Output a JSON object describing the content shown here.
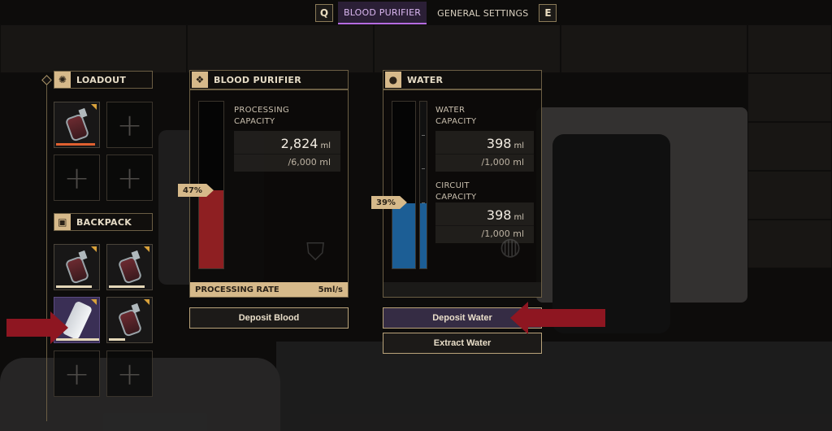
{
  "tabs": {
    "prev_key": "Q",
    "next_key": "E",
    "items": [
      {
        "label": "BLOOD PURIFIER",
        "active": true
      },
      {
        "label": "GENERAL SETTINGS",
        "active": false
      }
    ]
  },
  "loadout": {
    "title": "LOADOUT",
    "slots": [
      {
        "item": "blood-pack",
        "durability": 0.8
      },
      {
        "item": "empty"
      },
      {
        "item": "empty"
      },
      {
        "item": "empty"
      }
    ]
  },
  "backpack": {
    "title": "BACKPACK",
    "slots": [
      {
        "item": "blood-pack",
        "durability": 0.8
      },
      {
        "item": "blood-pack",
        "durability": 0.8
      },
      {
        "item": "water-canister",
        "durability": 1.0,
        "selected": true
      },
      {
        "item": "blood-pack",
        "durability": 0.35
      },
      {
        "item": "empty"
      },
      {
        "item": "empty"
      }
    ]
  },
  "blood_purifier": {
    "title": "BLOOD PURIFIER",
    "gauge_percent": "47%",
    "fill_fraction": 0.47,
    "fill_color": "#8e1f22",
    "stat_label_line1": "PROCESSING",
    "stat_label_line2": "CAPACITY",
    "value": "2,824",
    "unit": "ml",
    "max": "/6,000 ml",
    "rate_label": "PROCESSING RATE",
    "rate_value": "5ml/s",
    "deposit_button": "Deposit Blood"
  },
  "water": {
    "title": "WATER",
    "gauge_percent": "39%",
    "fill_fraction": 0.39,
    "fill_color": "#1c5e95",
    "water_label_line1": "WATER",
    "water_label_line2": "CAPACITY",
    "water_value": "398",
    "water_unit": "ml",
    "water_max": "/1,000 ml",
    "circuit_label_line1": "CIRCUIT",
    "circuit_label_line2": "CAPACITY",
    "circuit_value": "398",
    "circuit_unit": "ml",
    "circuit_max": "/1,000 ml",
    "deposit_button": "Deposit Water",
    "extract_button": "Extract Water"
  },
  "colors": {
    "accent": "#d6b98a",
    "tab_active": "#b56be0",
    "arrow": "#8e1621"
  }
}
